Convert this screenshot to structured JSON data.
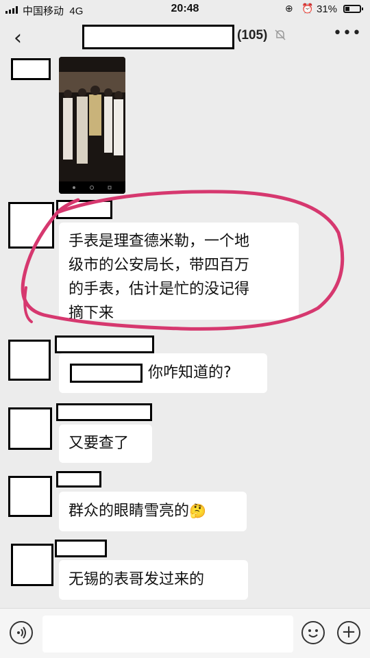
{
  "status": {
    "carrier": "中国移动",
    "network": "4G",
    "time": "20:48",
    "battery_percent": "31%",
    "battery_level": 0.31
  },
  "header": {
    "back_icon": "chevron-left-icon",
    "group_count": "(105)",
    "mute_icon": "bell-off-icon",
    "more_icon": "more-dots-icon"
  },
  "messages": [
    {
      "type": "image",
      "description_icon": "phone-photo"
    },
    {
      "type": "text",
      "lines": [
        "手表是理查德米勒，一个地",
        "级市的公安局长，带四百万",
        "的手表，估计是忙的没记得",
        "摘下来"
      ]
    },
    {
      "type": "text",
      "text": "你咋知道的?"
    },
    {
      "type": "text",
      "text": "又要查了"
    },
    {
      "type": "text",
      "text": "群众的眼睛雪亮的",
      "emoji": "🤔"
    },
    {
      "type": "text",
      "text": "无锡的表哥发过来的"
    }
  ],
  "annotation_color": "#d6386f",
  "input": {
    "voice_icon": "voice-icon",
    "emoji_icon": "smile-icon",
    "plus_icon": "plus-icon"
  }
}
